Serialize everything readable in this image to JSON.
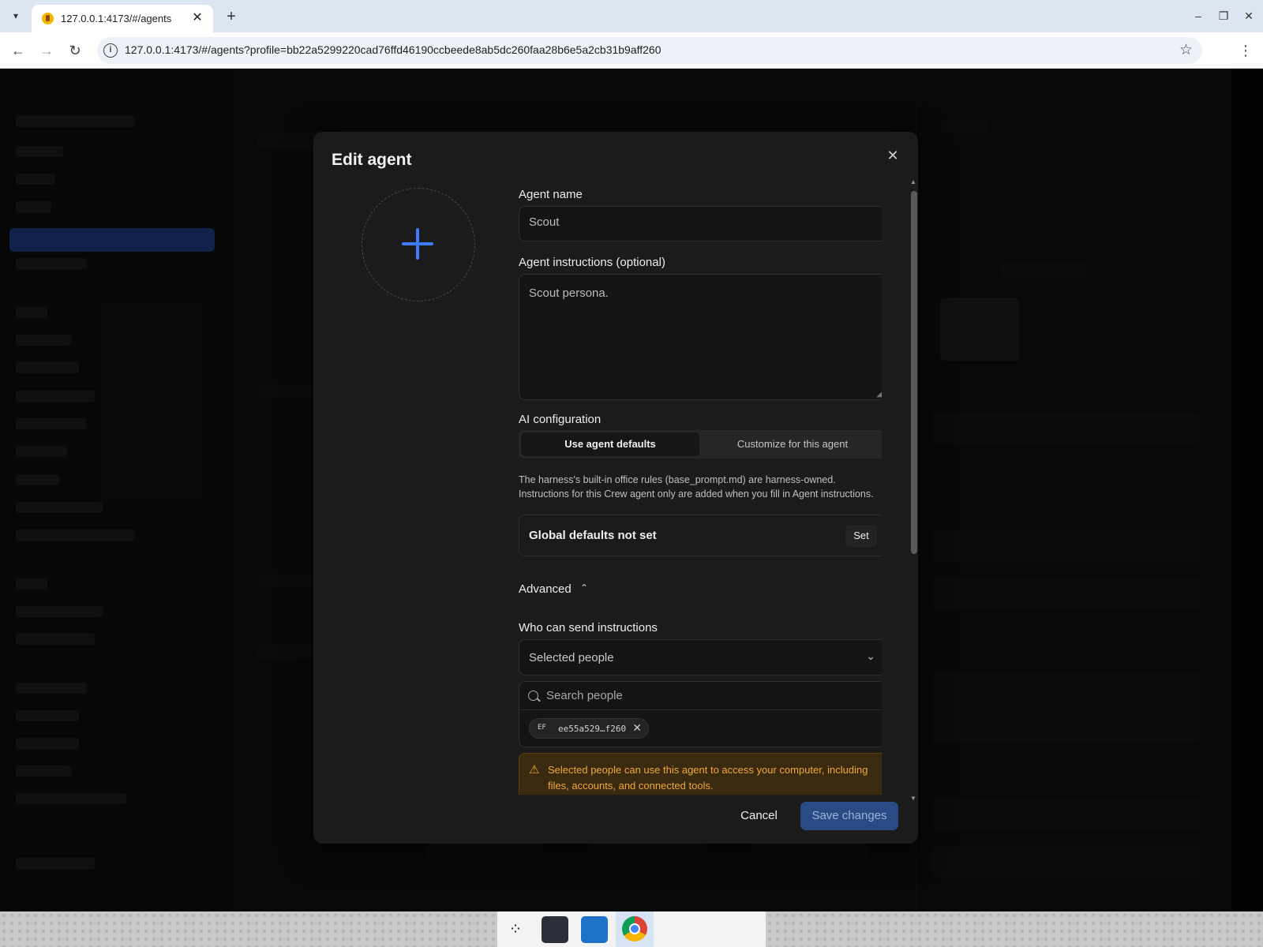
{
  "browser": {
    "tab_title": "127.0.0.1:4173/#/agents",
    "url": "127.0.0.1:4173/#/agents?profile=bb22a5299220cad76ffd46190ccbeede8ab5dc260faa28b6e5a2cb31b9aff260"
  },
  "modal": {
    "title": "Edit agent",
    "agent_name_label": "Agent name",
    "agent_name_value": "Scout",
    "instructions_label": "Agent instructions (optional)",
    "instructions_value": "Scout persona.",
    "ai_config_label": "AI configuration",
    "tab_defaults": "Use agent defaults",
    "tab_customize": "Customize for this agent",
    "help_line1": "The harness's built-in office rules (base_prompt.md) are harness-owned.",
    "help_line2": "Instructions for this Crew agent only are added when you fill in Agent instructions.",
    "defaults_card_title": "Global defaults not set",
    "set_button": "Set",
    "advanced_label": "Advanced",
    "who_label": "Who can send instructions",
    "who_value": "Selected people",
    "search_placeholder": "Search people",
    "chip_initials": "EF",
    "chip_id": "ee55a529…f260",
    "warning_text": "Selected people can use this agent to access your computer, including files, accounts, and connected tools.",
    "cancel_button": "Cancel",
    "save_button": "Save changes"
  },
  "icons": {
    "close": "close-icon",
    "plus": "plus-icon",
    "search": "search-icon",
    "warning": "warning-icon",
    "chevron_down": "chevron-down-icon",
    "chevron_up": "chevron-up-icon"
  },
  "colors": {
    "accent": "#3d7bff",
    "save_button_bg": "#2a4a86",
    "warning": "#f0a93a"
  }
}
